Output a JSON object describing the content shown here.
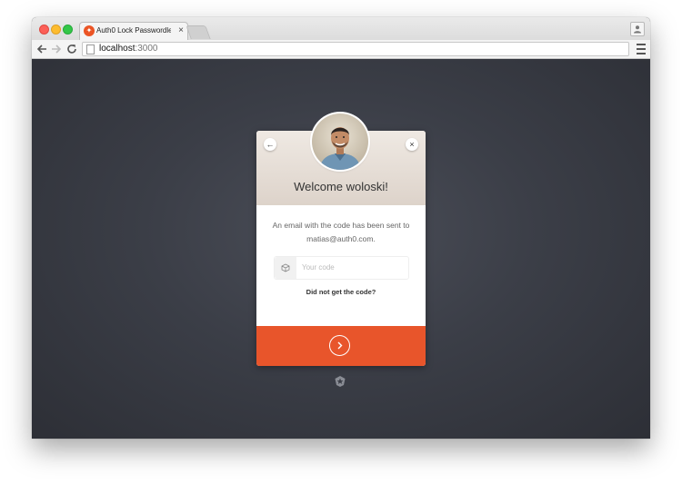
{
  "browser": {
    "tab_title": "Auth0 Lock Passwordless",
    "tab_close_glyph": "×",
    "url_host": "localhost",
    "url_port": ":3000",
    "icons": {
      "back": "arrow-left-icon",
      "forward": "arrow-right-icon",
      "reload": "reload-icon",
      "page": "page-icon",
      "menu": "hamburger-menu-icon",
      "profile": "person-icon"
    }
  },
  "lock": {
    "welcome": "Welcome woloski!",
    "message": "An email with the code has been sent to matias@auth0.com.",
    "code_placeholder": "Your code",
    "resend_link": "Did not get the code?",
    "back_glyph": "←",
    "close_glyph": "×",
    "icons": {
      "back": "arrow-left-icon",
      "close": "close-icon",
      "code": "cube-icon",
      "submit": "chevron-right-icon",
      "footer": "auth0-logo-icon"
    }
  },
  "colors": {
    "accent": "#e8552b",
    "header_bg": "#e6ded7",
    "page_bg": "#3b3e47"
  }
}
